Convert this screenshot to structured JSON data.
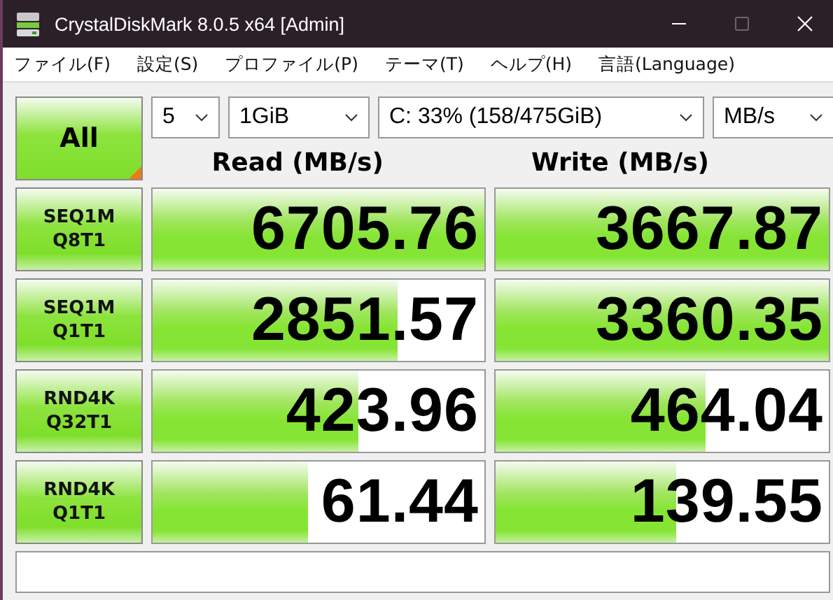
{
  "window": {
    "title": "CrystalDiskMark 8.0.5 x64 [Admin]"
  },
  "menu": [
    "ファイル(F)",
    "設定(S)",
    "プロファイル(P)",
    "テーマ(T)",
    "ヘルプ(H)",
    "言語(Language)"
  ],
  "all_button": {
    "label": "All"
  },
  "dropdowns": [
    {
      "value": "5"
    },
    {
      "value": "1GiB"
    },
    {
      "value": "C: 33% (158/475GiB)"
    },
    {
      "value": "MB/s"
    }
  ],
  "columns": [
    "Read (MB/s)",
    "Write (MB/s)"
  ],
  "tests": [
    {
      "label": [
        "SEQ1M",
        "Q8T1"
      ],
      "read": {
        "value": "6705.76",
        "level": 1.0
      },
      "write": {
        "value": "3667.87",
        "level": 1.0
      }
    },
    {
      "label": [
        "SEQ1M",
        "Q1T1"
      ],
      "read": {
        "value": "2851.57",
        "level": 0.74
      },
      "write": {
        "value": "3360.35",
        "level": 1.0
      }
    },
    {
      "label": [
        "RND4K",
        "Q32T1"
      ],
      "read": {
        "value": "423.96",
        "level": 0.62
      },
      "write": {
        "value": "464.04",
        "level": 0.63
      }
    },
    {
      "label": [
        "RND4K",
        "Q1T1"
      ],
      "read": {
        "value": "61.44",
        "level": 0.47
      },
      "write": {
        "value": "139.55",
        "level": 0.54
      }
    }
  ]
}
